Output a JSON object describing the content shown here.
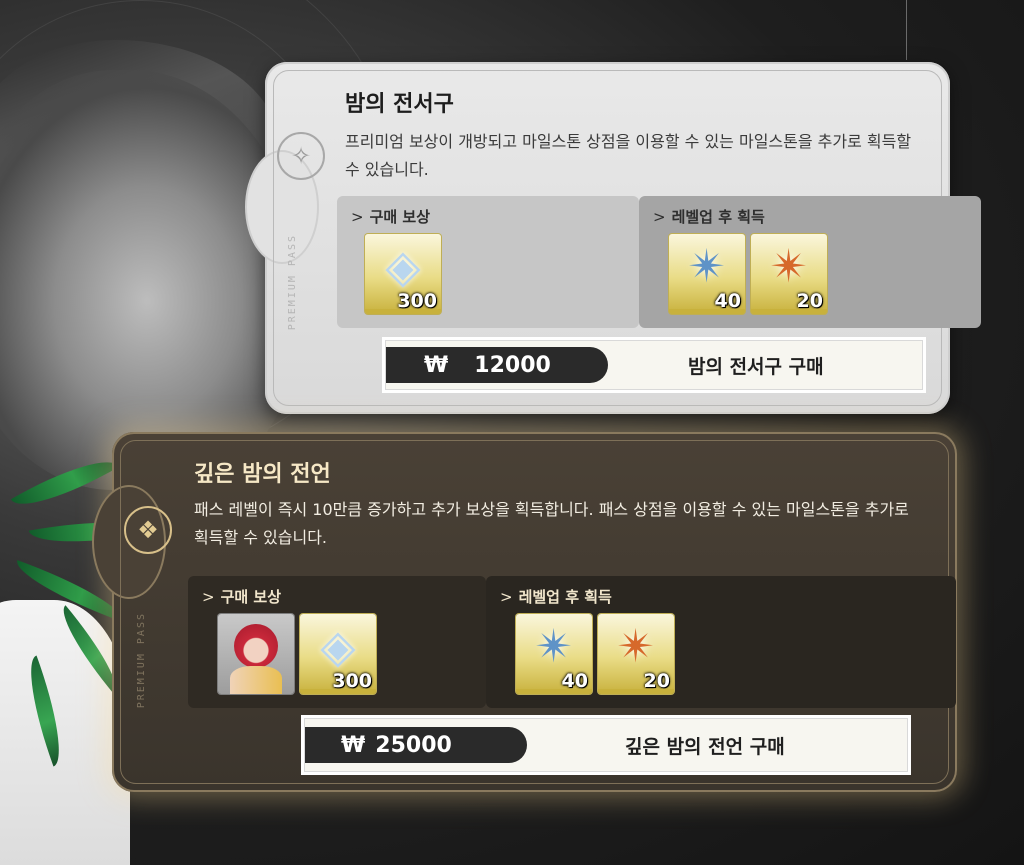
{
  "pass_basic": {
    "title": "밤의 전서구",
    "description": "프리미엄 보상이 개방되고 마일스톤 상점을 이용할 수 있는 마일스톤을 추가로 획득할 수 있습니다.",
    "vertical_label": "PREMIUM PASS",
    "purchase_rewards": {
      "label": "구매 보상",
      "items": [
        {
          "icon": "crystal-icon",
          "quantity": "300"
        }
      ]
    },
    "levelup_rewards": {
      "label": "레벨업 후 획득",
      "items": [
        {
          "icon": "blue-star-icon",
          "quantity": "40"
        },
        {
          "icon": "orange-star-icon",
          "quantity": "20"
        }
      ]
    },
    "price": {
      "currency": "₩",
      "amount": "12000"
    },
    "buy_label": "밤의 전서구 구매"
  },
  "pass_premium": {
    "title": "깊은 밤의 전언",
    "description": "패스 레벨이 즉시 10만큼 증가하고 추가 보상을 획득합니다. 패스 상점을 이용할 수 있는 마일스톤을 추가로 획득할 수 있습니다.",
    "vertical_label": "PREMIUM PASS",
    "purchase_rewards": {
      "label": "구매 보상",
      "items": [
        {
          "icon": "character-portrait-icon",
          "quantity": ""
        },
        {
          "icon": "crystal-icon",
          "quantity": "300"
        }
      ]
    },
    "levelup_rewards": {
      "label": "레벨업 후 획득",
      "items": [
        {
          "icon": "blue-star-icon",
          "quantity": "40"
        },
        {
          "icon": "orange-star-icon",
          "quantity": "20"
        }
      ]
    },
    "price": {
      "currency": "₩",
      "amount": "25000"
    },
    "buy_label": "깊은 밤의 전언 구매"
  },
  "colors": {
    "premium_glow": "#ffdc96",
    "premium_panel": "#3a342c",
    "basic_panel": "#dcdcdc"
  }
}
